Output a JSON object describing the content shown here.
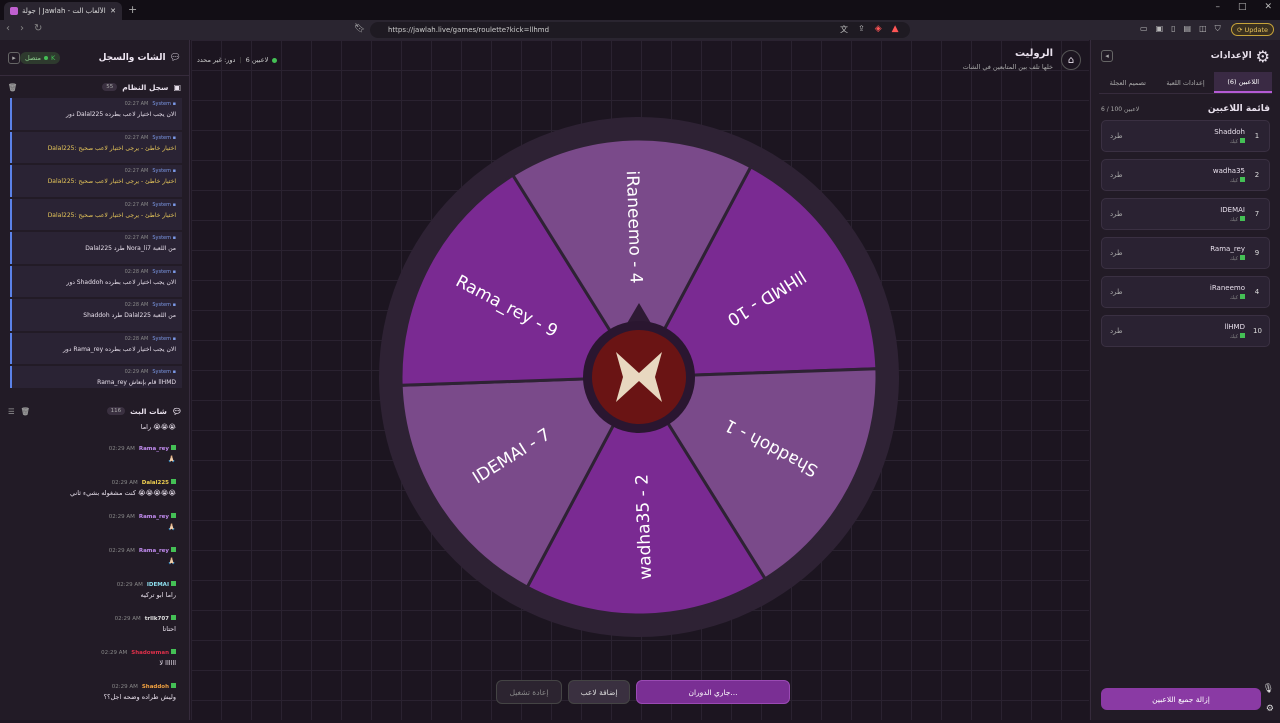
{
  "browser": {
    "tab_title": "جولة | Jawlah - منصة الألعاب الت...",
    "url": "https://jawlah.live/games/roulette?kick=llhmd",
    "update_label": "Update"
  },
  "chat_panel": {
    "title": "الشات والسجل",
    "status": "متصل",
    "system_log": {
      "title": "سجل النظام",
      "count": "55",
      "entries": [
        {
          "sender": "System",
          "time": "02:27 AM",
          "msg": "دور Dalal225 الان يجب اختيار لاعب بطرده",
          "warn": false
        },
        {
          "sender": "System",
          "time": "02:27 AM",
          "msg": "Dalal225: اختيار خاطئ - يرجى اختيار لاعب صحيح",
          "warn": true
        },
        {
          "sender": "System",
          "time": "02:27 AM",
          "msg": "Dalal225: اختيار خاطئ - يرجى اختيار لاعب صحيح",
          "warn": true
        },
        {
          "sender": "System",
          "time": "02:27 AM",
          "msg": "Dalal225: اختيار خاطئ - يرجى اختيار لاعب صحيح",
          "warn": true
        },
        {
          "sender": "System",
          "time": "02:27 AM",
          "msg": "Dalal225 طرد Nora_li7 من اللعبة",
          "warn": false
        },
        {
          "sender": "System",
          "time": "02:28 AM",
          "msg": "دور Shaddoh الان يجب اختيار لاعب بطرده",
          "warn": false
        },
        {
          "sender": "System",
          "time": "02:28 AM",
          "msg": "Shaddoh طرد Dalal225 من اللعبة",
          "warn": false
        },
        {
          "sender": "System",
          "time": "02:28 AM",
          "msg": "دور Rama_rey الان يجب اختيار لاعب بطرده",
          "warn": false
        },
        {
          "sender": "System",
          "time": "02:29 AM",
          "msg": "Rama_rey قام بإنعاش llHMD",
          "warn": false
        }
      ]
    },
    "live_chat": {
      "title": "شات البث",
      "count": "116",
      "messages": [
        {
          "name": "",
          "color": "#ffffff",
          "time": "",
          "text": "راما 😭😭😭"
        },
        {
          "name": "Rama_rey",
          "color": "#c28cf0",
          "time": "02:29 AM",
          "text": "🙏🏻"
        },
        {
          "name": "Dalal225",
          "color": "#f0d050",
          "time": "02:29 AM",
          "text": "كنت مشغوله بشيء ثاني 😭😭😭😭😭"
        },
        {
          "name": "Rama_rey",
          "color": "#c28cf0",
          "time": "02:29 AM",
          "text": "🙏🏻"
        },
        {
          "name": "Rama_rey",
          "color": "#c28cf0",
          "time": "02:29 AM",
          "text": "🙏🏻"
        },
        {
          "name": "IDEMAI",
          "color": "#8ee0f0",
          "time": "02:29 AM",
          "text": "راما ابو تركيه"
        },
        {
          "name": "trllk707",
          "color": "#e0e0e0",
          "time": "02:29 AM",
          "text": "احتاتا"
        },
        {
          "name": "Shadowman",
          "color": "#e0304a",
          "time": "02:29 AM",
          "text": "لا llllll"
        },
        {
          "name": "Shaddoh",
          "color": "#f0a040",
          "time": "02:29 AM",
          "text": "وليش طراده وضحه اجل؟؟"
        }
      ]
    }
  },
  "game": {
    "title": "الروليت",
    "subtitle": "خلها تلف بين المتابعين في الشات",
    "players_count": "6 لاعبين",
    "turn": "دور: غير محدد",
    "wheel_segments": [
      {
        "label": "llHMD - 10",
        "color": "#7a2a92"
      },
      {
        "label": "Shaddoh - 1",
        "color": "#7a4a8a"
      },
      {
        "label": "wadha35 - 2",
        "color": "#7a2a92"
      },
      {
        "label": "IDEMAI - 7",
        "color": "#7a4a8a"
      },
      {
        "label": "Rama_rey - 9",
        "color": "#7a2a92"
      },
      {
        "label": "iRaneemo - 4",
        "color": "#7a4a8a"
      }
    ],
    "buttons": {
      "spin": "جاري الدوران...",
      "add_player": "إضافة لاعب",
      "restart": "إعادة تشغيل"
    }
  },
  "settings": {
    "title": "الإعدادات",
    "tabs": [
      "اللاعبين (6)",
      "إعدادات اللعبة",
      "تصميم العجلة"
    ],
    "player_list_title": "قائمة اللاعبين",
    "player_list_count": "6 / 100 لاعبين",
    "kick_label": "طرد",
    "kick_sub": "كيك",
    "players": [
      {
        "num": "1",
        "name": "Shaddoh"
      },
      {
        "num": "2",
        "name": "wadha35"
      },
      {
        "num": "7",
        "name": "IDEMAI"
      },
      {
        "num": "9",
        "name": "Rama_rey"
      },
      {
        "num": "4",
        "name": "iRaneemo"
      },
      {
        "num": "10",
        "name": "llHMD"
      }
    ],
    "remove_all": "إزالة جميع اللاعبين"
  }
}
